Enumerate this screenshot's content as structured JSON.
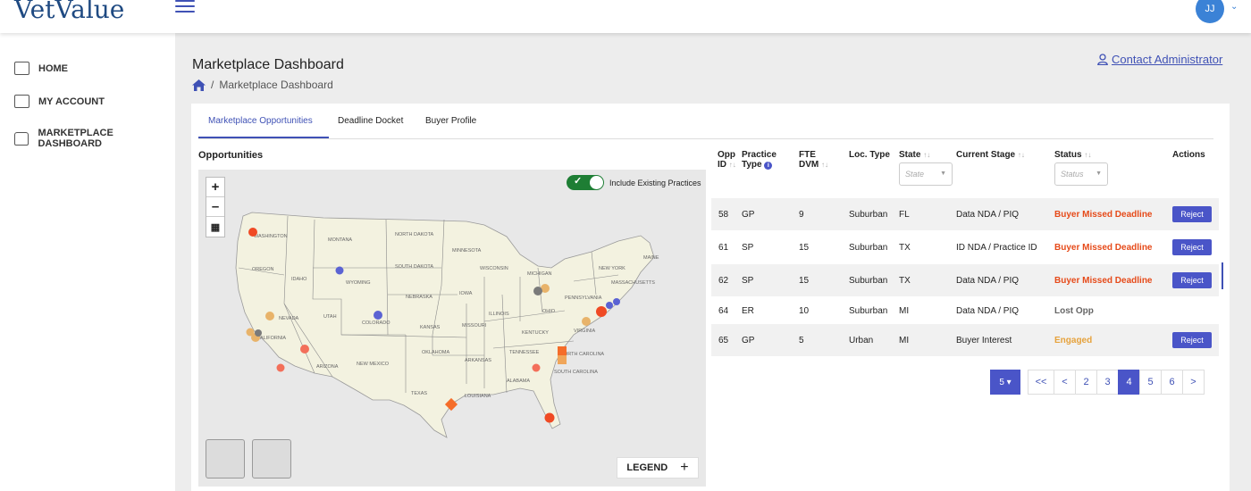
{
  "app": {
    "logo": "VetValue",
    "user_initials": "JJ"
  },
  "sidebar": {
    "items": [
      {
        "label": "HOME",
        "icon": "monitor-icon"
      },
      {
        "label": "MY ACCOUNT",
        "icon": "id-card-icon"
      },
      {
        "label": "MARKETPLACE DASHBOARD",
        "icon": "box-icon"
      }
    ]
  },
  "page": {
    "title": "Marketplace Dashboard",
    "breadcrumb": "Marketplace Dashboard",
    "contact_link": "Contact Administrator"
  },
  "tabs": [
    "Marketplace Opportunities",
    "Deadline Docket",
    "Buyer Profile"
  ],
  "opportunities": {
    "title": "Opportunities",
    "toggle_label": "Include Existing Practices",
    "toggle_on": true,
    "legend_label": "LEGEND",
    "state_labels": [
      "WASHINGTON",
      "MONTANA",
      "NORTH DAKOTA",
      "MINNESOTA",
      "OREGON",
      "IDAHO",
      "SOUTH DAKOTA",
      "WISCONSIN",
      "WYOMING",
      "MICHIGAN",
      "NEBRASKA",
      "IOWA",
      "NEVADA",
      "UTAH",
      "COLORADO",
      "ILLINOIS",
      "OHIO",
      "PENNSYLVANIA",
      "KANSAS",
      "MISSOURI",
      "KENTUCKY",
      "VIRGINIA",
      "CALIFORNIA",
      "OKLAHOMA",
      "TENNESSEE",
      "ARIZONA",
      "NEW MEXICO",
      "ARKANSAS",
      "NORTH CAROLINA",
      "SOUTH CAROLINA",
      "ALABAMA",
      "TEXAS",
      "LOUISIANA",
      "MAINE",
      "MASSACHUSETTS",
      "NEW YORK"
    ]
  },
  "table": {
    "headers": {
      "opp_id": "Opp ID",
      "practice_type": "Practice Type",
      "fte_dvm": "FTE DVM",
      "loc_type": "Loc. Type",
      "state": "State",
      "current_stage": "Current Stage",
      "status": "Status",
      "actions": "Actions"
    },
    "filters": {
      "state_placeholder": "State",
      "status_placeholder": "Status"
    },
    "rows": [
      {
        "id": "58",
        "type": "GP",
        "fte": "9",
        "loc": "Suburban",
        "state": "FL",
        "stage": "Data NDA / PIQ",
        "status": "Buyer Missed Deadline",
        "status_kind": "red",
        "action": "Reject"
      },
      {
        "id": "61",
        "type": "SP",
        "fte": "15",
        "loc": "Suburban",
        "state": "TX",
        "stage": "ID NDA / Practice ID",
        "status": "Buyer Missed Deadline",
        "status_kind": "red",
        "action": "Reject"
      },
      {
        "id": "62",
        "type": "SP",
        "fte": "15",
        "loc": "Suburban",
        "state": "TX",
        "stage": "Data NDA / PIQ",
        "status": "Buyer Missed Deadline",
        "status_kind": "red",
        "action": "Reject"
      },
      {
        "id": "64",
        "type": "ER",
        "fte": "10",
        "loc": "Suburban",
        "state": "MI",
        "stage": "Data NDA / PIQ",
        "status": "Lost Opp",
        "status_kind": "grey",
        "action": ""
      },
      {
        "id": "65",
        "type": "GP",
        "fte": "5",
        "loc": "Urban",
        "state": "MI",
        "stage": "Buyer Interest",
        "status": "Engaged",
        "status_kind": "orange",
        "action": "Reject"
      }
    ]
  },
  "pagination": {
    "per_page": "5",
    "pages": [
      "<<",
      "<",
      "2",
      "3",
      "4",
      "5",
      "6",
      ">"
    ],
    "active": "4"
  },
  "colors": {
    "accent": "#4a55c8",
    "missed": "#e64a19",
    "engaged": "#e6a23c",
    "toggle": "#1e7e34"
  }
}
